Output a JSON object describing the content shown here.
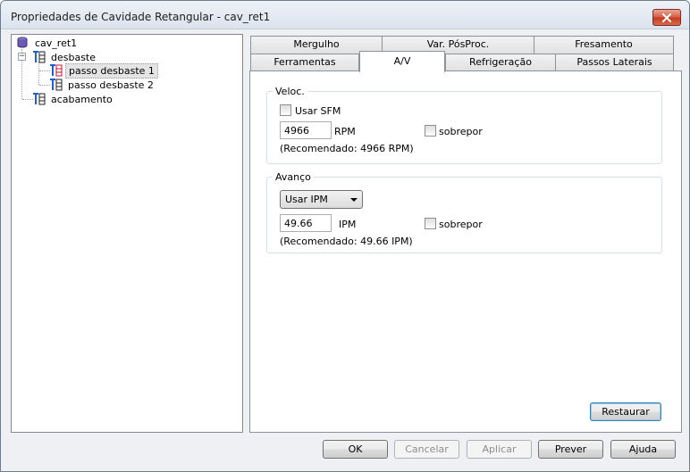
{
  "window": {
    "title": "Propriedades de Cavidade Retangular - cav_ret1",
    "close_icon": "close-icon"
  },
  "tree": {
    "root": "cav_ret1",
    "items": [
      {
        "label": "desbaste"
      },
      {
        "label": "passo desbaste 1",
        "selected": true
      },
      {
        "label": "passo desbaste 2"
      },
      {
        "label": "acabamento"
      }
    ]
  },
  "tabs": {
    "row_back": [
      "Mergulho",
      "Var. PósProc.",
      "Fresamento"
    ],
    "row_front": [
      "Ferramentas",
      "A/V",
      "Refrigeração",
      "Passos Laterais"
    ],
    "active": "A/V"
  },
  "speed": {
    "group_title": "Veloc.",
    "use_sfm_label": "Usar SFM",
    "value": "4966",
    "unit": "RPM",
    "override_label": "sobrepor",
    "recommended": "(Recomendado: 4966 RPM)"
  },
  "feed": {
    "group_title": "Avanço",
    "mode_selected": "Usar IPM",
    "value": "49.66",
    "unit": "IPM",
    "override_label": "sobrepor",
    "recommended": "(Recomendado: 49.66 IPM)"
  },
  "buttons": {
    "restore": "Restaurar",
    "ok": "OK",
    "cancel": "Cancelar",
    "apply": "Aplicar",
    "preview": "Prever",
    "help": "Ajuda"
  },
  "colors": {
    "accent_blue": "#1f5fd6",
    "accent_red": "#c8102e",
    "close_red": "#c23a20"
  }
}
